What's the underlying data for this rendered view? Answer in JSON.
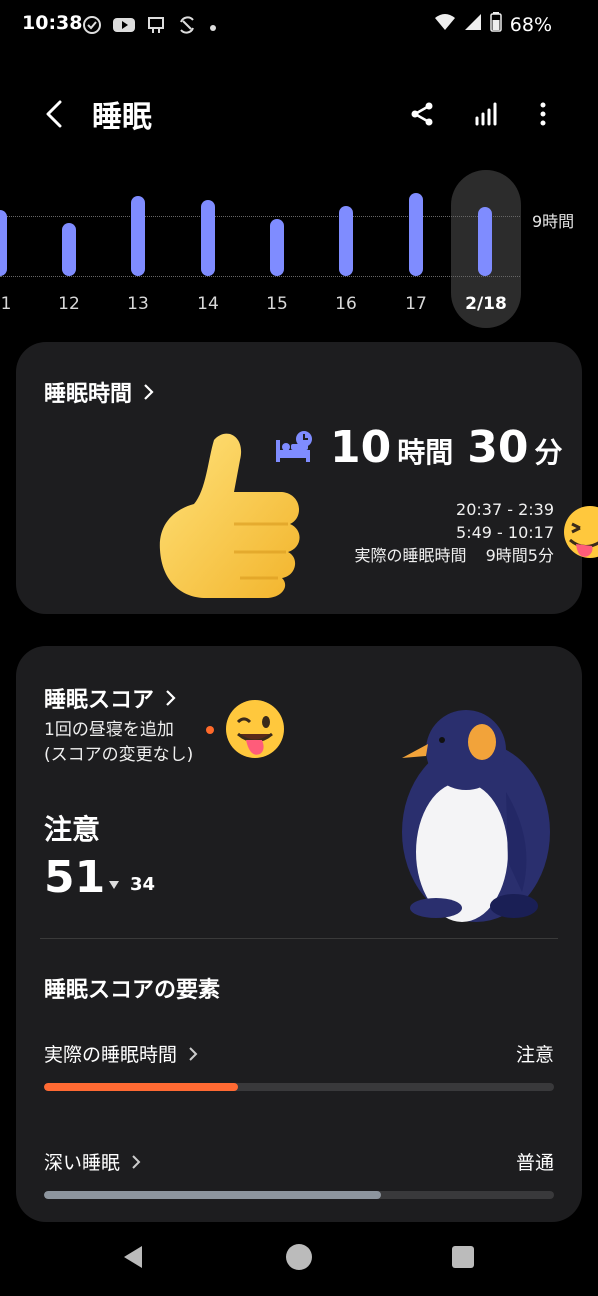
{
  "status_bar": {
    "time": "10:38",
    "battery": "68%"
  },
  "header": {
    "title": "睡眠"
  },
  "week_chart": {
    "y_label": "9時間",
    "days": [
      "1",
      "12",
      "13",
      "14",
      "15",
      "16",
      "17",
      "2/18"
    ],
    "selected_index": 7,
    "bar_color": "#7F8CFF"
  },
  "sleep_time_card": {
    "title": "睡眠時間",
    "hours_value": "10",
    "hours_unit": "時間",
    "minutes_value": "30",
    "minutes_unit": "分",
    "interval1": "20:37 - 2:39",
    "interval2": "5:49 - 10:17",
    "actual_label": "実際の睡眠時間",
    "actual_value": "9時間5分"
  },
  "score_card": {
    "title": "睡眠スコア",
    "nap_line1": "1回の昼寝を追加",
    "nap_line2": "(スコアの変更なし)",
    "status": "注意",
    "score": "51",
    "delta": "34",
    "factors_title": "睡眠スコアの要素",
    "factors": [
      {
        "label": "実際の睡眠時間",
        "status": "注意",
        "progress": 0.38,
        "color": "#FF6A33"
      },
      {
        "label": "深い睡眠",
        "status": "普通",
        "progress": 0.66,
        "color": "#8D959E"
      }
    ]
  }
}
